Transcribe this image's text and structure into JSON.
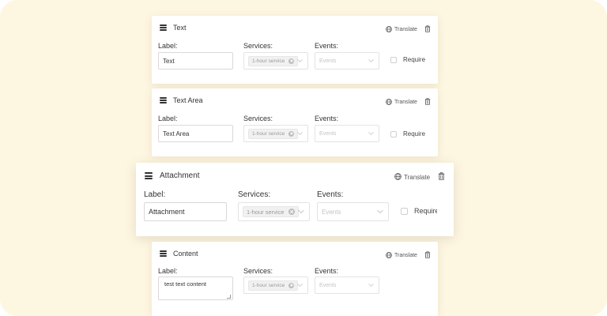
{
  "form_fields": [
    {
      "title": "Text",
      "translate_label": "Translate",
      "label_caption": "Label:",
      "label_value": "Text",
      "services_caption": "Services:",
      "service_tag": "1-hour service",
      "events_caption": "Events:",
      "events_placeholder": "Events",
      "required_label": "Required"
    },
    {
      "title": "Text Area",
      "translate_label": "Translate",
      "label_caption": "Label:",
      "label_value": "Text Area",
      "services_caption": "Services:",
      "service_tag": "1-hour service",
      "events_caption": "Events:",
      "events_placeholder": "Events",
      "required_label": "Required"
    },
    {
      "title": "Attachment",
      "translate_label": "Translate",
      "label_caption": "Label:",
      "label_value": "Attachment",
      "services_caption": "Services:",
      "service_tag": "1-hour service",
      "events_caption": "Events:",
      "events_placeholder": "Events",
      "required_label": "Required"
    },
    {
      "title": "Content",
      "translate_label": "Translate",
      "label_caption": "Label:",
      "content_value": "test text content",
      "services_caption": "Services:",
      "service_tag": "1-hour service",
      "events_caption": "Events:",
      "events_placeholder": "Events"
    }
  ],
  "colors": {
    "backdrop": "#fdf6e1",
    "card": "#ffffff",
    "tag_background": "#f1f1f1",
    "placeholder": "#c4c4c4"
  }
}
